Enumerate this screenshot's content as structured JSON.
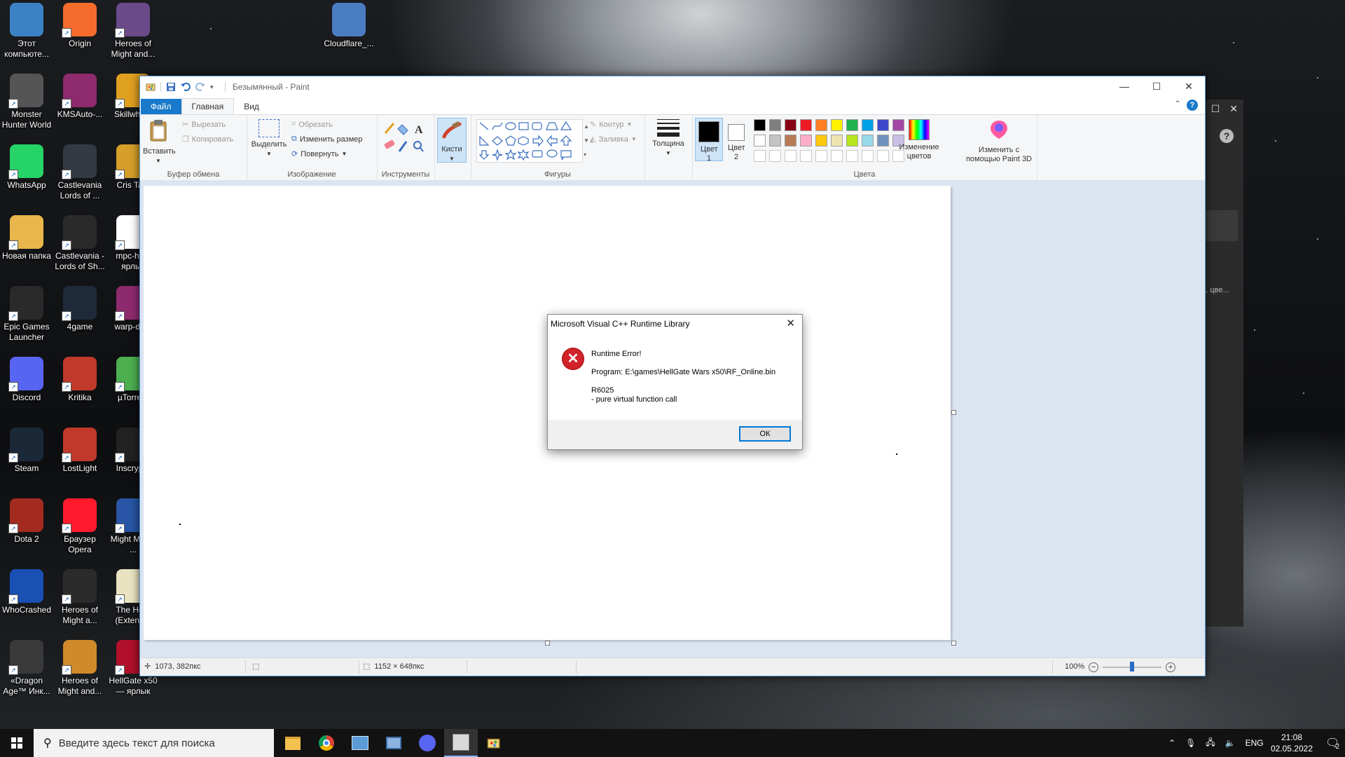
{
  "desktop": {
    "icons": [
      {
        "label": "Этот компьюте...",
        "icon": "computer-icon",
        "color": "#3b82c4"
      },
      {
        "label": "Origin",
        "icon": "origin-icon",
        "color": "#f56c2d"
      },
      {
        "label": "Heroes of Might and...",
        "icon": "game-icon",
        "color": "#6b4a8a"
      },
      {
        "label": "Cloudflare_...",
        "icon": "installer-icon",
        "color": "#4a7cc2"
      },
      {
        "label": "Monster Hunter World",
        "icon": "game-icon",
        "color": "#555555"
      },
      {
        "label": "KMSAuto-...",
        "icon": "archive-icon",
        "color": "#8e2a6e"
      },
      {
        "label": "Skillwhe...",
        "icon": "app-icon",
        "color": "#e0a020"
      },
      {
        "label": "WhatsApp",
        "icon": "whatsapp-icon",
        "color": "#25d366"
      },
      {
        "label": "Castlevania Lords of ...",
        "icon": "game-icon",
        "color": "#333a44"
      },
      {
        "label": "Cris Ta...",
        "icon": "app-icon",
        "color": "#d69f2a"
      },
      {
        "label": "Новая папка",
        "icon": "folder-icon",
        "color": "#e8b64a"
      },
      {
        "label": "Castlevania - Lords of Sh...",
        "icon": "game-icon",
        "color": "#2a2a2a"
      },
      {
        "label": "mpc-hc... ярлык",
        "icon": "media-icon",
        "color": "#ffffff"
      },
      {
        "label": "Epic Games Launcher",
        "icon": "epic-icon",
        "color": "#2a2a2a"
      },
      {
        "label": "4game",
        "icon": "game-icon",
        "color": "#1e2a3a"
      },
      {
        "label": "warp-de...",
        "icon": "archive-icon",
        "color": "#8e2a6e"
      },
      {
        "label": "Discord",
        "icon": "discord-icon",
        "color": "#5865f2"
      },
      {
        "label": "Kritika",
        "icon": "game-icon",
        "color": "#c0392b"
      },
      {
        "label": "µTorre...",
        "icon": "utorrent-icon",
        "color": "#4caf50"
      },
      {
        "label": "Steam",
        "icon": "steam-icon",
        "color": "#1b2838"
      },
      {
        "label": "LostLight",
        "icon": "game-icon",
        "color": "#c0392b"
      },
      {
        "label": "Inscryp...",
        "icon": "game-icon",
        "color": "#222222"
      },
      {
        "label": "Dota 2",
        "icon": "dota-icon",
        "color": "#a32a1f"
      },
      {
        "label": "Браузер Opera",
        "icon": "opera-icon",
        "color": "#ff1b2d"
      },
      {
        "label": "Might Magic ...",
        "icon": "game-icon",
        "color": "#2855a6"
      },
      {
        "label": "WhoCrashed",
        "icon": "app-icon",
        "color": "#1a4fb3"
      },
      {
        "label": "Heroes of Might a...",
        "icon": "game-icon",
        "color": "#2b2b2b"
      },
      {
        "label": "The Ho... (Extend...",
        "icon": "document-icon",
        "color": "#e9e3c2"
      },
      {
        "label": "«Dragon Age™ Инк...",
        "icon": "game-icon",
        "color": "#3a3a3a"
      },
      {
        "label": "Heroes of Might and...",
        "icon": "game-icon",
        "color": "#d08a2a"
      },
      {
        "label": "HellGate x50 — ярлык",
        "icon": "game-icon",
        "color": "#b0102a"
      }
    ]
  },
  "background_window": {
    "partial_text": "ю, цве..."
  },
  "paint": {
    "title": "Безымянный - Paint",
    "window_controls": {
      "minimize": "—",
      "maximize": "☐",
      "close": "✕"
    },
    "tabs": [
      "Файл",
      "Главная",
      "Вид"
    ],
    "help": "?",
    "ribbon": {
      "clipboard": {
        "paste": "Вставить",
        "cut": "Вырезать",
        "copy": "Копировать",
        "label": "Буфер обмена"
      },
      "image": {
        "select": "Выделить",
        "crop": "Обрезать",
        "resize": "Изменить размер",
        "rotate": "Повернуть",
        "label": "Изображение"
      },
      "tools": {
        "label": "Инструменты"
      },
      "brushes": {
        "label": "Кисти"
      },
      "shapes": {
        "outline": "Контур",
        "fill": "Заливка",
        "label": "Фигуры"
      },
      "size": {
        "label": "Толщина"
      },
      "colors": {
        "color1": "Цвет 1",
        "color2": "Цвет 2",
        "edit": "Изменение цветов",
        "label": "Цвета",
        "palette_row1": [
          "#000000",
          "#7f7f7f",
          "#880015",
          "#ed1c24",
          "#ff7f27",
          "#fff200",
          "#22b14c",
          "#00a2e8",
          "#3f48cc",
          "#a349a4"
        ],
        "palette_row2": [
          "#ffffff",
          "#c3c3c3",
          "#b97a57",
          "#ffaec9",
          "#ffc90e",
          "#efe4b0",
          "#b5e61d",
          "#99d9ea",
          "#7092be",
          "#c8bfe7"
        ]
      },
      "paint3d": {
        "label": "Изменить с помощью Paint 3D"
      }
    },
    "status": {
      "cursor": "1073, 382пкс",
      "canvas_size": "1152 × 648пкс",
      "zoom": "100%",
      "zoom_level_fraction": 0.5
    }
  },
  "dialog": {
    "title": "Microsoft Visual C++ Runtime Library",
    "close": "✕",
    "line1": "Runtime Error!",
    "line2": "Program: E:\\games\\HellGate Wars x50\\RF_Online.bin",
    "line3": "R6025",
    "line4": "- pure virtual function call",
    "ok": "ОК"
  },
  "taskbar": {
    "search_placeholder": "Введите здесь текст для поиска",
    "lang": "ENG",
    "time": "21:08",
    "date": "02.05.2022",
    "notification_count": "2"
  }
}
